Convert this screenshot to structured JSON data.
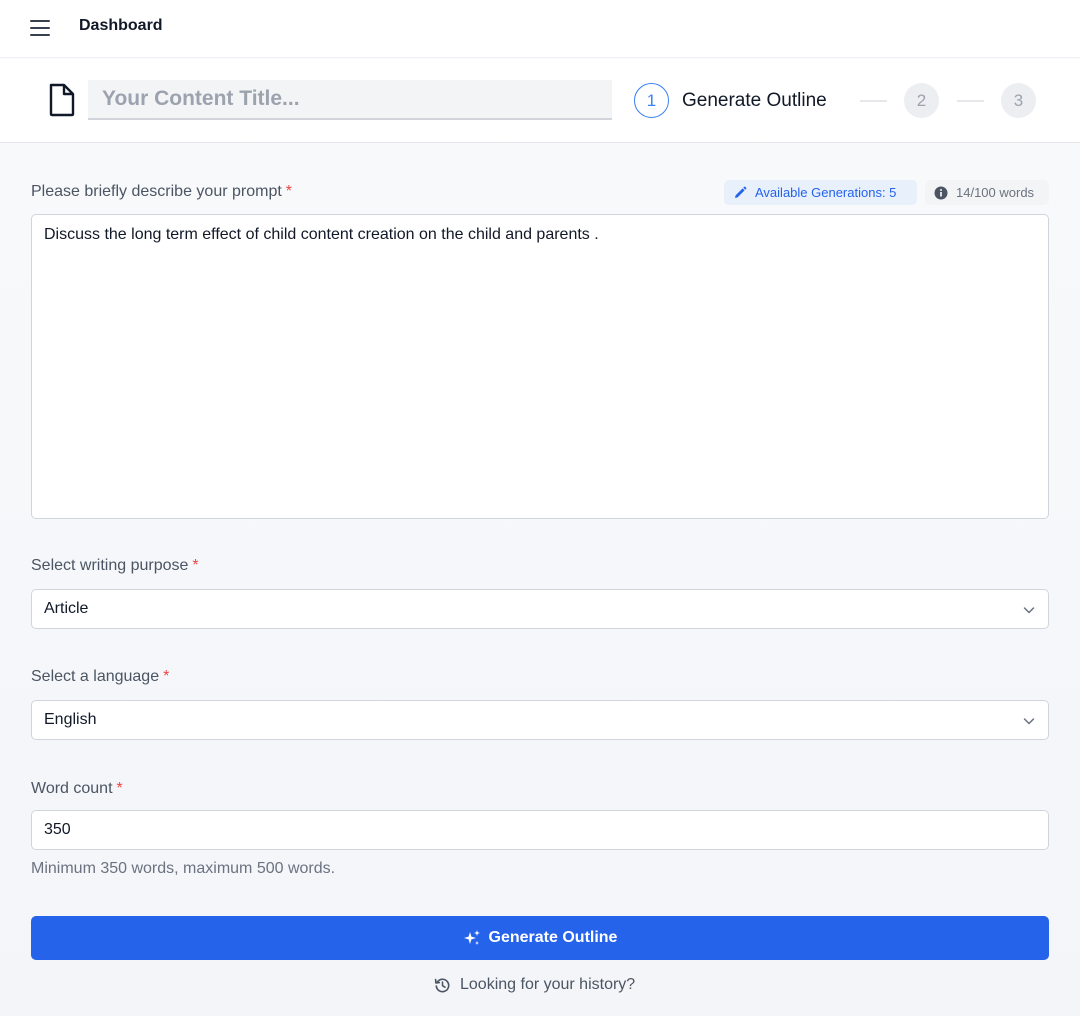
{
  "header": {
    "title": "Dashboard"
  },
  "title_bar": {
    "placeholder": "Your Content Title...",
    "value": ""
  },
  "stepper": {
    "steps": [
      {
        "number": "1",
        "label": "Generate Outline",
        "active": true
      },
      {
        "number": "2",
        "label": "",
        "active": false
      },
      {
        "number": "3",
        "label": "",
        "active": false
      }
    ]
  },
  "prompt": {
    "label": "Please briefly describe your prompt",
    "required_mark": "*",
    "available_generations": "Available Generations: 5",
    "word_counter": "14/100 words",
    "value": "Discuss the long term effect of child content creation on the child and parents ."
  },
  "purpose": {
    "label": "Select writing purpose",
    "required_mark": "*",
    "selected": "Article"
  },
  "language": {
    "label": "Select a language",
    "required_mark": "*",
    "selected": "English"
  },
  "word_count": {
    "label": "Word count",
    "required_mark": "*",
    "value": "350",
    "help": "Minimum 350 words, maximum 500 words."
  },
  "actions": {
    "generate_label": "Generate Outline",
    "history_label": "Looking for your history?"
  },
  "colors": {
    "primary": "#2563eb",
    "required": "#ef4444",
    "step_active": "#3b82f6"
  },
  "icons": {
    "menu": "hamburger-menu-icon",
    "document": "document-icon",
    "pencil": "pencil-icon",
    "info": "info-icon",
    "chevron": "chevron-down-icon",
    "sparkle": "sparkles-icon",
    "history": "history-icon"
  }
}
